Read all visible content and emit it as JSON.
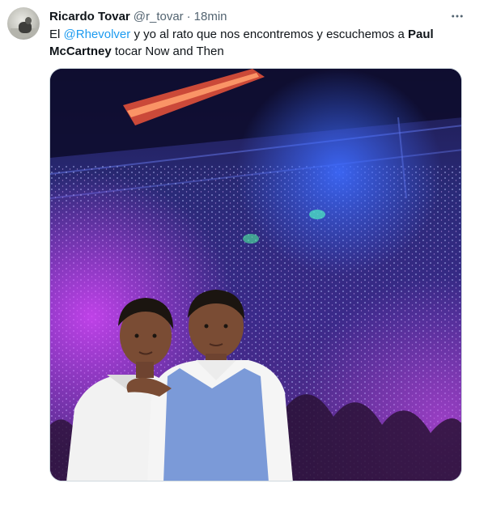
{
  "tweet": {
    "author_name": "Ricardo Tovar",
    "author_handle": "@r_tovar",
    "separator": "·",
    "time": "18min",
    "text_part1": "El ",
    "mention": "@Rhevolver",
    "text_part2": " y yo al rato que nos encontremos y escuchemos a ",
    "bold_text": "Paul McCartney",
    "text_part3": " tocar Now and Then"
  },
  "icons": {
    "more": "more-horizontal-icon",
    "avatar": "profile-avatar"
  },
  "colors": {
    "link": "#1d9bf0",
    "secondary_text": "#536471",
    "primary_text": "#0f1419",
    "border": "#cfd9de"
  },
  "media": {
    "kind": "photo",
    "subject": "two boys edited into a concert crowd with purple lights"
  }
}
